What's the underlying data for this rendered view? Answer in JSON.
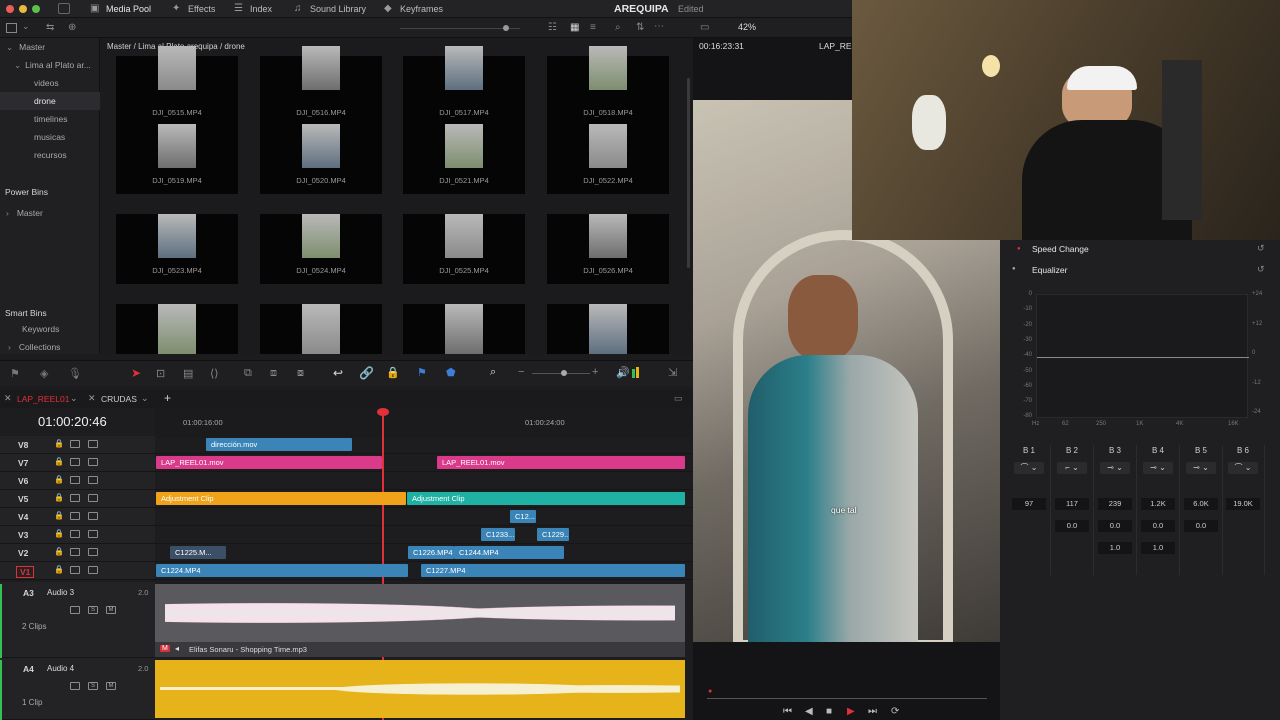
{
  "topbar": {
    "tabs": [
      {
        "label": "Media Pool",
        "icon": "media-pool-icon"
      },
      {
        "label": "Effects",
        "icon": "effects-icon"
      },
      {
        "label": "Index",
        "icon": "index-icon"
      },
      {
        "label": "Sound Library",
        "icon": "sound-library-icon"
      },
      {
        "label": "Keyframes",
        "icon": "keyframes-icon"
      }
    ],
    "project_title": "AREQUIPA",
    "project_status": "Edited",
    "zoom": "42%"
  },
  "bins": {
    "master": "Master",
    "project": "Lima al Plato ar...",
    "items": [
      "videos",
      "drone",
      "timelines",
      "musicas",
      "recursos"
    ],
    "power_bins": "Power Bins",
    "power_master": "Master",
    "smart_bins": "Smart Bins",
    "smart_items": [
      "Keywords",
      "Collections"
    ]
  },
  "pool": {
    "breadcrumb": "Master / Lima al Plato arequipa / drone",
    "clips": [
      "DJI_0515.MP4",
      "DJI_0516.MP4",
      "DJI_0517.MP4",
      "DJI_0518.MP4",
      "DJI_0519.MP4",
      "DJI_0520.MP4",
      "DJI_0521.MP4",
      "DJI_0522.MP4",
      "DJI_0523.MP4",
      "DJI_0524.MP4",
      "DJI_0525.MP4",
      "DJI_0526.MP4"
    ]
  },
  "viewer": {
    "timecode": "00:16:23:31",
    "clip_name": "LAP_REEL",
    "subtitle": "que tal"
  },
  "timeline": {
    "tabs": [
      "LAP_REEL01",
      "CRUDAS"
    ],
    "timecode": "01:00:20:46",
    "ruler": [
      "01:00:16:00",
      "01:00:24:00"
    ],
    "tracks": [
      "V8",
      "V7",
      "V6",
      "V5",
      "V4",
      "V3",
      "V2",
      "V1"
    ],
    "clips": {
      "v8a": "dirección.mov",
      "v7a": "LAP_REEL01.mov",
      "v7b": "LAP_REEL01.mov",
      "v5a": "Adjustment Clip",
      "v5b": "Adjustment Clip",
      "v4a": "C12...",
      "v3a": "C1233...",
      "v3b": "C1229...",
      "v2a": "C1225.M...",
      "v2b": "C1226.MP4",
      "v2c": "C1244.MP4",
      "v1a": "C1224.MP4",
      "v1b": "C1227.MP4"
    },
    "audio3": {
      "id": "A3",
      "name": "Audio 3",
      "level": "2.0",
      "clips": "2 Clips"
    },
    "audio_clip": "Elifas Sonaru - Shopping Time.mp3",
    "audio4": {
      "id": "A4",
      "name": "Audio 4",
      "level": "2.0",
      "clips": "1 Clip"
    }
  },
  "inspector": {
    "speed_change": "Speed Change",
    "equalizer": "Equalizer",
    "db_labels": [
      "0",
      "-10",
      "-20",
      "-30",
      "-40",
      "-50",
      "-60",
      "-70",
      "-80"
    ],
    "db_right": [
      "+24",
      "+12",
      "0",
      "-12",
      "-24"
    ],
    "freq_labels": [
      "Hz",
      "62",
      "250",
      "1K",
      "4K",
      "16K"
    ],
    "bands": [
      "B 1",
      "B 2",
      "B 3",
      "B 4",
      "B 5",
      "B 6"
    ],
    "freq_values": [
      "97",
      "117",
      "239",
      "1.2K",
      "6.0K",
      "19.0K"
    ],
    "gain_values": [
      "0.0",
      "0.0",
      "0.0",
      "0.0"
    ],
    "q_values": [
      "1.0",
      "1.0"
    ]
  },
  "colors": {
    "accent_red": "#e0303a",
    "clip_blue": "#3a84b8",
    "clip_pink": "#d93a8a",
    "clip_orange": "#f0a21a",
    "clip_teal": "#1fb1a3",
    "audio_yellow": "#e6b31a"
  }
}
